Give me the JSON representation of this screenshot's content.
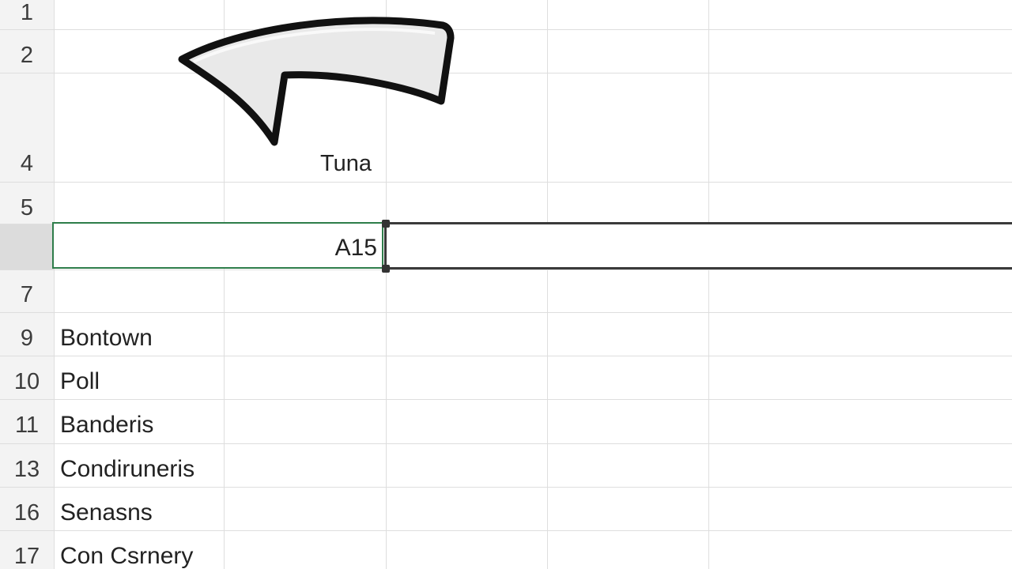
{
  "rows": [
    {
      "num": "1",
      "text": ""
    },
    {
      "num": "2",
      "text": ""
    },
    {
      "num": "4",
      "text": "Tuna"
    },
    {
      "num": "5",
      "text": ""
    },
    {
      "num": "",
      "text": ""
    },
    {
      "num": "7",
      "text": ""
    },
    {
      "num": "9",
      "text": "Bontown"
    },
    {
      "num": "10",
      "text": "Poll"
    },
    {
      "num": "11",
      "text": "Banderis"
    },
    {
      "num": "13",
      "text": "Condiruneris"
    },
    {
      "num": "16",
      "text": "Senasns"
    },
    {
      "num": "17",
      "text": "Con Csrnery"
    }
  ],
  "active_cell": {
    "value": "A15"
  },
  "colors": {
    "selection_border": "#2e7d4a",
    "range_border": "#3a3a3a",
    "gridline": "#dedede",
    "row_header_bg": "#f3f3f3"
  },
  "icons": {
    "arrow": "curved-arrow-left-icon"
  }
}
